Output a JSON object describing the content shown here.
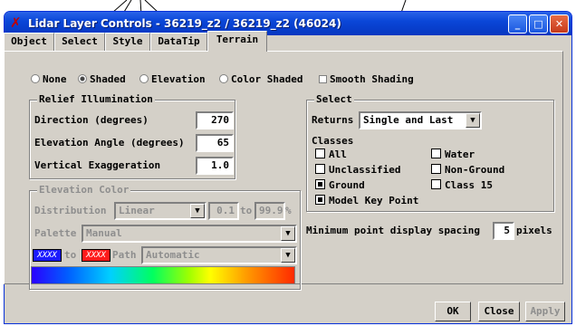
{
  "window": {
    "title": "Lidar Layer Controls - 36219_z2 / 36219_z2 (46024)",
    "controls": {
      "minimize": "_",
      "maximize": "□",
      "close": "✕"
    }
  },
  "tabs": [
    "Object",
    "Select",
    "Style",
    "DataTip",
    "Terrain"
  ],
  "active_tab": "Terrain",
  "shading": {
    "options": [
      "None",
      "Shaded",
      "Elevation",
      "Color Shaded"
    ],
    "selected": "Shaded",
    "smooth_label": "Smooth Shading"
  },
  "relief": {
    "legend": "Relief Illumination",
    "direction_label": "Direction (degrees)",
    "direction_value": "270",
    "elevation_label": "Elevation Angle (degrees)",
    "elevation_value": "65",
    "exaggeration_label": "Vertical Exaggeration",
    "exaggeration_value": "1.0"
  },
  "elevation_color": {
    "legend": "Elevation Color",
    "distribution_label": "Distribution",
    "distribution_value": "Linear",
    "from_value": "0.1",
    "to_label": "to",
    "to_value": "99.9",
    "percent": "%",
    "palette_label": "Palette",
    "palette_value": "Manual",
    "swatch_text": "XXXX",
    "swatch_to": "to",
    "path_label": "Path",
    "path_value": "Automatic"
  },
  "select": {
    "legend": "Select",
    "returns_label": "Returns",
    "returns_value": "Single and Last",
    "classes_label": "Classes",
    "classes": [
      {
        "label": "All",
        "checked": false
      },
      {
        "label": "Water",
        "checked": false
      },
      {
        "label": "Unclassified",
        "checked": false
      },
      {
        "label": "Non-Ground",
        "checked": false
      },
      {
        "label": "Ground",
        "checked": true
      },
      {
        "label": "Class 15",
        "checked": false
      },
      {
        "label": "Model Key Point",
        "checked": true
      }
    ]
  },
  "spacing": {
    "label": "Minimum point display spacing",
    "value": "5",
    "units": "pixels"
  },
  "buttons": {
    "ok": "OK",
    "close": "Close",
    "apply": "Apply"
  },
  "colors": {
    "titlebar": "#0a46d8",
    "face": "#d4d0c8",
    "swatch_from": "#1a1aff",
    "swatch_to": "#ff1a1a"
  }
}
